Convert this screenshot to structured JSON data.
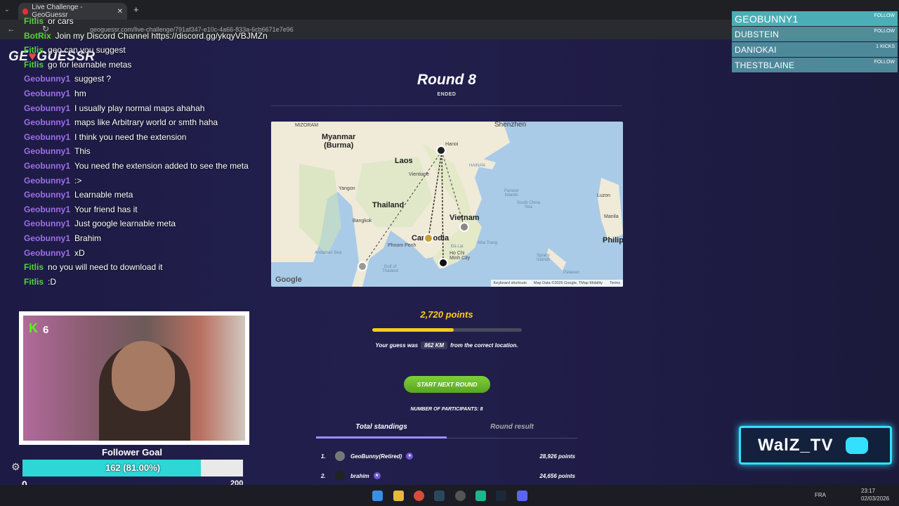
{
  "browser": {
    "tab_title": "Live Challenge - GeoGuessr",
    "url": "geoguessr.com/live-challenge/791af347-e10c-4a66-833a-6cb6671e7e96"
  },
  "logo": {
    "text_a": "GE",
    "text_b": "GUESSR"
  },
  "chat": [
    {
      "user": "Fitlis",
      "color": "green",
      "msg": "or cars"
    },
    {
      "user": "BotRix",
      "color": "green",
      "msg": "Join my Discord Channel https://discord.gg/ykqyVBJMZn"
    },
    {
      "user": "Fitlis",
      "color": "green",
      "msg": "geo can you suggest"
    },
    {
      "user": "Fitlis",
      "color": "green",
      "msg": "go for learnable metas"
    },
    {
      "user": "Geobunny1",
      "color": "purple",
      "msg": "suggest ?"
    },
    {
      "user": "Geobunny1",
      "color": "purple",
      "msg": "hm"
    },
    {
      "user": "Geobunny1",
      "color": "purple",
      "msg": "I usually play normal maps ahahah"
    },
    {
      "user": "Geobunny1",
      "color": "purple",
      "msg": "maps like Arbitrary world or smth haha"
    },
    {
      "user": "Geobunny1",
      "color": "purple",
      "msg": "I think you need the extension"
    },
    {
      "user": "Geobunny1",
      "color": "purple",
      "msg": "This"
    },
    {
      "user": "Geobunny1",
      "color": "purple",
      "msg": "You need the extension added to see the meta"
    },
    {
      "user": "Geobunny1",
      "color": "purple",
      "msg": ":>"
    },
    {
      "user": "Geobunny1",
      "color": "purple",
      "msg": "Learnable meta"
    },
    {
      "user": "Geobunny1",
      "color": "purple",
      "msg": "Your friend has it"
    },
    {
      "user": "Geobunny1",
      "color": "purple",
      "msg": "Just google learnable meta"
    },
    {
      "user": "Geobunny1",
      "color": "purple",
      "msg": "Brahim"
    },
    {
      "user": "Geobunny1",
      "color": "purple",
      "msg": "xD"
    },
    {
      "user": "Fitlis",
      "color": "green",
      "msg": "no you will need to download it"
    },
    {
      "user": "Fitlis",
      "color": "green",
      "msg": ":D"
    }
  ],
  "round": {
    "title": "Round 8",
    "status": "ENDED",
    "points": "2,720 points",
    "progress": 0.544,
    "guess_prefix": "Your guess was",
    "distance": "862 KM",
    "guess_suffix": "from the correct location.",
    "next_button": "START NEXT ROUND",
    "participants": "NUMBER OF PARTICIPANTS: 8"
  },
  "map": {
    "labels": {
      "mizoram": "MIZORAM",
      "myanmar": "Myanmar\n(Burma)",
      "shenzhen": "Shenzhen",
      "hanoi": "Hanoi",
      "laos": "Laos",
      "hainan": "HAINAN",
      "vientiane": "Vientiane",
      "yangon": "Yangon",
      "thailand": "Thailand",
      "vietnam": "Vietnam",
      "bangkok": "Bangkok",
      "cambodia": "Cambodia",
      "phnompenh": "Phnom Penh",
      "hochiminh": "Ho Chi\nMinh City",
      "luzon": "Luzon",
      "manila": "Manila",
      "philip": "Philip",
      "southchinasea": "South China\nSea",
      "andaman": "Andaman Sea",
      "gulf": "Gulf of\nThailand",
      "paracel": "Paracel\nIslands",
      "nhatrang": "Nha Trang",
      "dalat": "Đà Lạt",
      "spratly": "Spratly\nIslands",
      "palawan": "Palawan"
    },
    "google": "Google",
    "attrib": [
      "Keyboard shortcuts",
      "Map Data ©2026 Google, TMap Mobility",
      "Terms"
    ]
  },
  "standings": {
    "tab_total": "Total standings",
    "tab_round": "Round result",
    "rows": [
      {
        "rank": "1.",
        "name": "GeoBunny(Retired)",
        "points": "28,926 points"
      },
      {
        "rank": "2.",
        "name": "brahim",
        "points": "24,656 points"
      }
    ]
  },
  "stream_panel": [
    {
      "name": "GEOBUNNY1",
      "tag": "FOLLOW"
    },
    {
      "name": "DUBSTEIN",
      "tag": "FOLLOW"
    },
    {
      "name": "DANIOKAI",
      "tag": "1 KICKS"
    },
    {
      "name": "THESTBLAINE",
      "tag": "FOLLOW"
    }
  ],
  "webcam": {
    "kick_count": "6",
    "kick_letter": "K"
  },
  "follower_goal": {
    "title": "Follower Goal",
    "text": "162 (81.00%)",
    "progress": 0.81,
    "min": "0",
    "max": "200"
  },
  "walz": {
    "text": "WalZ_TV"
  },
  "taskbar": {
    "lang": "FRA",
    "time": "23:17",
    "date": "02/03/2026"
  }
}
